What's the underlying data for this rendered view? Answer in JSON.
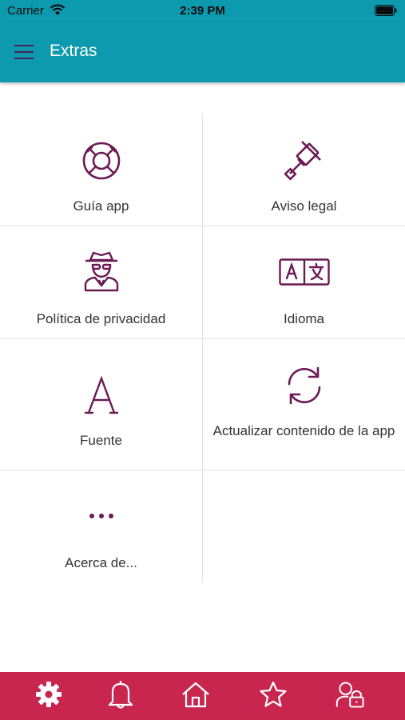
{
  "status_bar": {
    "carrier": "Carrier",
    "time": "2:39 PM"
  },
  "app_bar": {
    "title": "Extras"
  },
  "colors": {
    "header": "#0e9aae",
    "tab_bar": "#c8264e",
    "icon": "#6b1a54"
  },
  "grid": {
    "items": [
      {
        "label": "Guía app",
        "icon": "lifebuoy-icon"
      },
      {
        "label": "Aviso legal",
        "icon": "gavel-icon"
      },
      {
        "label": "Política de privacidad",
        "icon": "spy-icon"
      },
      {
        "label": "Idioma",
        "icon": "translate-icon"
      },
      {
        "label": "Fuente",
        "icon": "font-icon"
      },
      {
        "label": "Actualizar contenido de la app",
        "icon": "refresh-icon"
      },
      {
        "label": "Acerca de...",
        "icon": "more-icon"
      }
    ]
  },
  "tab_bar": {
    "tabs": [
      {
        "icon": "gear-icon",
        "active": true
      },
      {
        "icon": "bell-icon"
      },
      {
        "icon": "home-icon"
      },
      {
        "icon": "star-icon"
      },
      {
        "icon": "user-lock-icon"
      }
    ]
  }
}
